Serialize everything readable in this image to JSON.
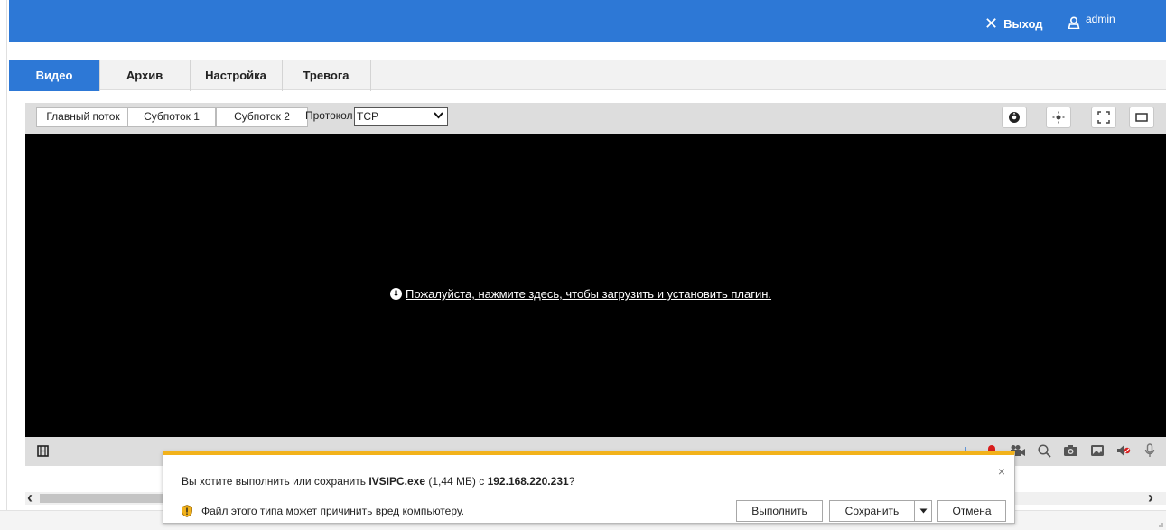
{
  "header": {
    "logout_label": "Выход",
    "close_glyph": "✕",
    "user_name": "admin",
    "bg_color": "#2d78d6"
  },
  "tabs": [
    {
      "label": "Видео",
      "active": true
    },
    {
      "label": "Архив",
      "active": false
    },
    {
      "label": "Настройка",
      "active": false
    },
    {
      "label": "Тревога",
      "active": false
    }
  ],
  "stream": {
    "main_label": "Главный поток",
    "sub1_label": "Субпоток 1",
    "sub2_label": "Субпоток 2",
    "protocol_label": "Протокол",
    "protocol_value": "TCP",
    "toolbar_icons": [
      "ptz-icon",
      "brightness-icon",
      "fullscreen-icon",
      "window-icon"
    ]
  },
  "video": {
    "plugin_message": "Пожалуйста, нажмите здесь, чтобы загрузить и установить плагин."
  },
  "bottom_toolbar": {
    "left_icons": [
      "film-strip-icon"
    ],
    "right_icons": [
      "grid-icon",
      "record-icon",
      "camera-video-icon",
      "zoom-icon",
      "snapshot-icon",
      "image-icon",
      "mute-icon",
      "microphone-icon"
    ]
  },
  "download_dialog": {
    "question_prefix": "Вы хотите выполнить или сохранить ",
    "file_name": "IVSIPC.exe",
    "file_size": " (1,44 МБ) с ",
    "host": "192.168.220.231",
    "question_suffix": "?",
    "warning": "Файл этого типа может причинить вред компьютеру.",
    "run_label": "Выполнить",
    "save_label": "Сохранить",
    "cancel_label": "Отмена",
    "close_glyph": "×",
    "accent_color": "#f2b21b"
  },
  "scrollbar": {
    "left_arrow": "‹",
    "right_arrow": "›"
  }
}
